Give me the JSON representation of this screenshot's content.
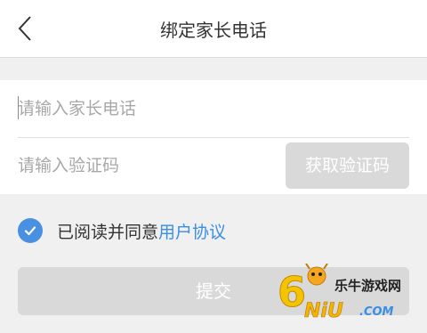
{
  "header": {
    "title": "绑定家长电话",
    "back_icon": "chevron-left-icon"
  },
  "form": {
    "phone_placeholder": "请输入家长电话",
    "phone_value": "",
    "code_placeholder": "请输入验证码",
    "code_value": "",
    "get_code_label": "获取验证码"
  },
  "agreement": {
    "checked": true,
    "text": "已阅读并同意",
    "link": "用户协议"
  },
  "submit_label": "提交",
  "watermark": {
    "text": "乐牛游戏网",
    "logo_text": "6NiU.COM"
  },
  "colors": {
    "accent": "#4a90e2",
    "link": "#3a8ee6",
    "disabled_button": "#d9d9d9",
    "background": "#f0f0f0"
  }
}
